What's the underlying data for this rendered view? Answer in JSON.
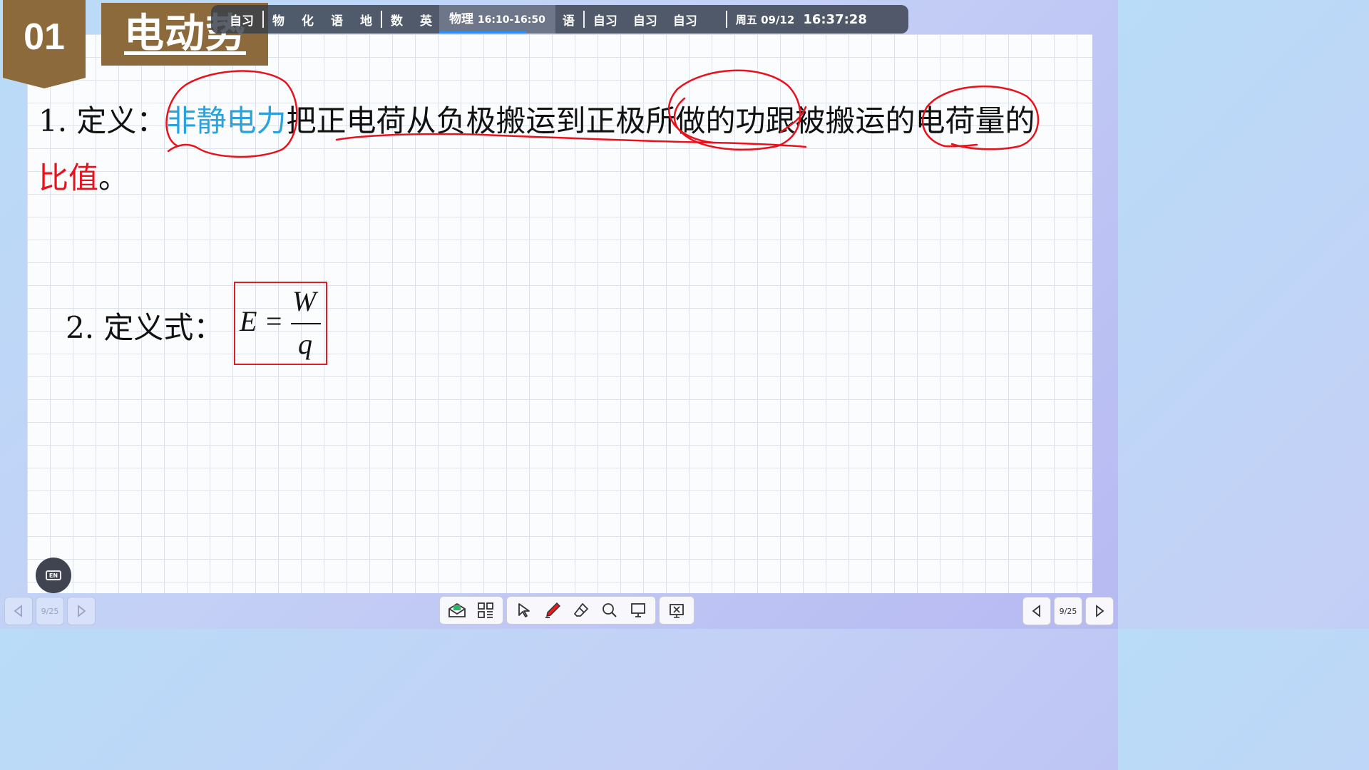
{
  "section": {
    "number": "01",
    "title": "电动势"
  },
  "schedule": {
    "items": [
      {
        "label": "自习"
      },
      {
        "sep": true
      },
      {
        "label": "物"
      },
      {
        "label": "化"
      },
      {
        "label": "语"
      },
      {
        "label": "地"
      },
      {
        "sep": true
      },
      {
        "label": "数"
      },
      {
        "label": "英"
      },
      {
        "current": true,
        "label": "物理",
        "time": "16:10-16:50"
      },
      {
        "label": "语"
      },
      {
        "sep": true
      },
      {
        "label": "自习"
      },
      {
        "label": "自习"
      },
      {
        "label": "自习"
      },
      {
        "sep": true
      }
    ],
    "date": "周五 09/12",
    "clock": "16:37:28"
  },
  "content": {
    "def_prefix": "1. 定义：",
    "def_highlight": "非静电力",
    "def_rest": "把正电荷从负极搬运到正极所做的功跟被搬运的电荷量的",
    "def_end_red": "比值",
    "def_end_punct": "。",
    "formula_label": "2. 定义式：",
    "formula": {
      "lhs": "E =",
      "numerator": "W",
      "denominator": "q"
    }
  },
  "bottom": {
    "en_label": "EN",
    "page_left": "9/25",
    "page_right": "9/25"
  },
  "colors": {
    "accent_brown": "#8d6a3b",
    "highlight_blue": "#2aa3dd",
    "highlight_red": "#e8121d",
    "annotation_red": "#e8121d"
  },
  "icons": [
    "prev-page-icon",
    "next-page-icon",
    "email-icon",
    "apps-grid-icon",
    "cursor-icon",
    "pen-icon",
    "eraser-icon",
    "search-icon",
    "projector-icon",
    "exit-icon",
    "en-keyboard-icon"
  ]
}
